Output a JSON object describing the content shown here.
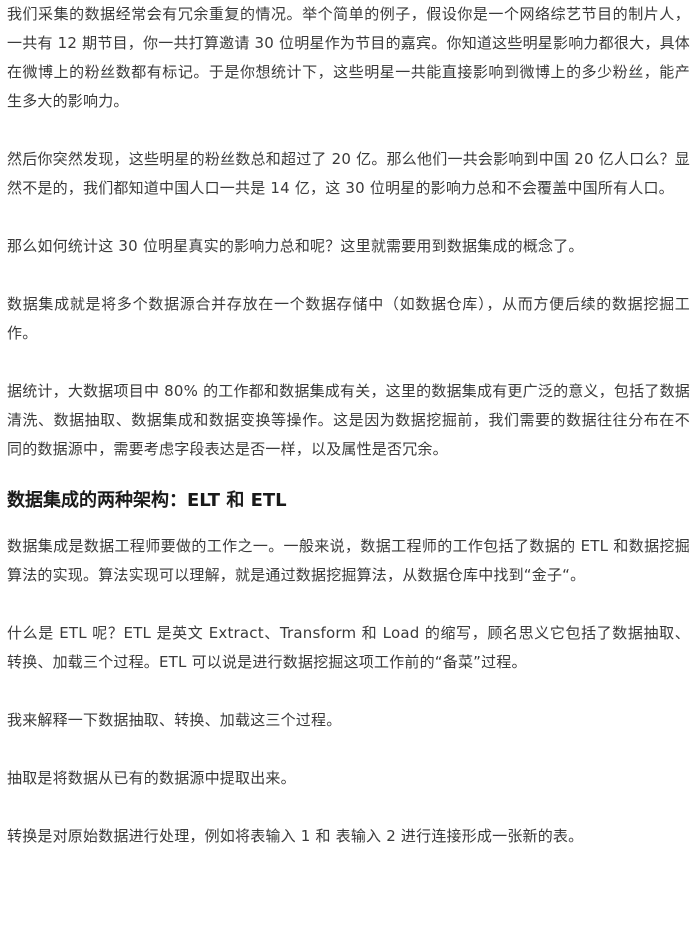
{
  "article": {
    "paragraphs": [
      "我们采集的数据经常会有冗余重复的情况。举个简单的例子，假设你是一个网络综艺节目的制片人，一共有 12 期节目，你一共打算邀请 30 位明星作为节目的嘉宾。你知道这些明星影响力都很大，具体在微博上的粉丝数都有标记。于是你想统计下，这些明星一共能直接影响到微博上的多少粉丝，能产生多大的影响力。",
      "然后你突然发现，这些明星的粉丝数总和超过了 20 亿。那么他们一共会影响到中国 20 亿人口么？显然不是的，我们都知道中国人口一共是 14 亿，这 30 位明星的影响力总和不会覆盖中国所有人口。",
      "那么如何统计这 30 位明星真实的影响力总和呢？这里就需要用到数据集成的概念了。",
      "数据集成就是将多个数据源合并存放在一个数据存储中（如数据仓库），从而方便后续的数据挖掘工作。",
      "据统计，大数据项目中 80% 的工作都和数据集成有关，这里的数据集成有更广泛的意义，包括了数据清洗、数据抽取、数据集成和数据变换等操作。这是因为数据挖掘前，我们需要的数据往往分布在不同的数据源中，需要考虑字段表达是否一样，以及属性是否冗余。"
    ],
    "heading": "数据集成的两种架构：ELT 和 ETL",
    "paragraphs_after": [
      "数据集成是数据工程师要做的工作之一。一般来说，数据工程师的工作包括了数据的 ETL 和数据挖掘算法的实现。算法实现可以理解，就是通过数据挖掘算法，从数据仓库中找到“金子“。",
      "什么是 ETL 呢？ETL 是英文 Extract、Transform 和 Load 的缩写，顾名思义它包括了数据抽取、转换、加载三个过程。ETL 可以说是进行数据挖掘这项工作前的“备菜”过程。",
      "我来解释一下数据抽取、转换、加载这三个过程。",
      "抽取是将数据从已有的数据源中提取出来。",
      "转换是对原始数据进行处理，例如将表输入 1 和 表输入 2 进行连接形成一张新的表。"
    ]
  }
}
